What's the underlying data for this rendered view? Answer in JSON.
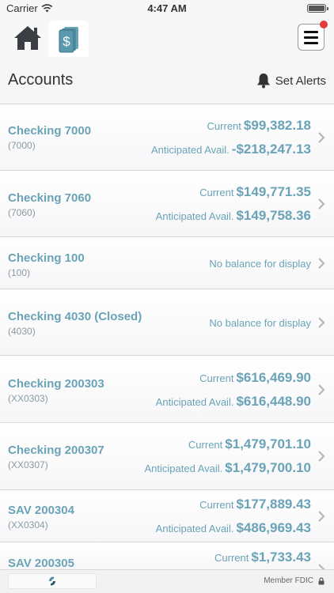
{
  "status_bar": {
    "carrier": "Carrier",
    "time": "4:47 AM"
  },
  "nav": {
    "home_icon": "home-icon",
    "accounts_icon": "dollar-cards-icon",
    "menu_icon": "hamburger-menu-icon",
    "menu_badge_color": "#e63b3b"
  },
  "header": {
    "title": "Accounts",
    "alerts_label": "Set Alerts",
    "alerts_icon": "bell-icon"
  },
  "accounts": [
    {
      "name": "Checking 7000",
      "number": "(7000)",
      "current_label": "Current",
      "current": "$99,382.18",
      "anticipated_label": "Anticipated Avail.",
      "anticipated": "-$218,247.13"
    },
    {
      "name": "Checking 7060",
      "number": "(7060)",
      "current_label": "Current",
      "current": "$149,771.35",
      "anticipated_label": "Anticipated Avail.",
      "anticipated": "$149,758.36"
    },
    {
      "name": "Checking 100",
      "number": "(100)",
      "no_balance": "No balance for display"
    },
    {
      "name": "Checking 4030 (Closed)",
      "number": "(4030)",
      "no_balance": "No balance for display"
    },
    {
      "name": "Checking 200303",
      "number": "(XX0303)",
      "current_label": "Current",
      "current": "$616,469.90",
      "anticipated_label": "Anticipated Avail.",
      "anticipated": "$616,448.90"
    },
    {
      "name": "Checking 200307",
      "number": "(XX0307)",
      "current_label": "Current",
      "current": "$1,479,701.10",
      "anticipated_label": "Anticipated Avail.",
      "anticipated": "$1,479,700.10"
    },
    {
      "name": "SAV 200304",
      "number": "(XX0304)",
      "current_label": "Current",
      "current": "$177,889.43",
      "anticipated_label": "Anticipated Avail.",
      "anticipated": "$486,969.43"
    },
    {
      "name": "SAV 200305",
      "number": "",
      "current_label": "Current",
      "current": "$1,733.43"
    }
  ],
  "footer": {
    "member_fdic": "Member FDIC",
    "lock_icon": "lock-icon",
    "logo_icon": "bank-logo-icon"
  },
  "colors": {
    "accent": "#6aa3b7",
    "header_bg": "#f6f6f6",
    "divider": "#d8d8d8"
  }
}
